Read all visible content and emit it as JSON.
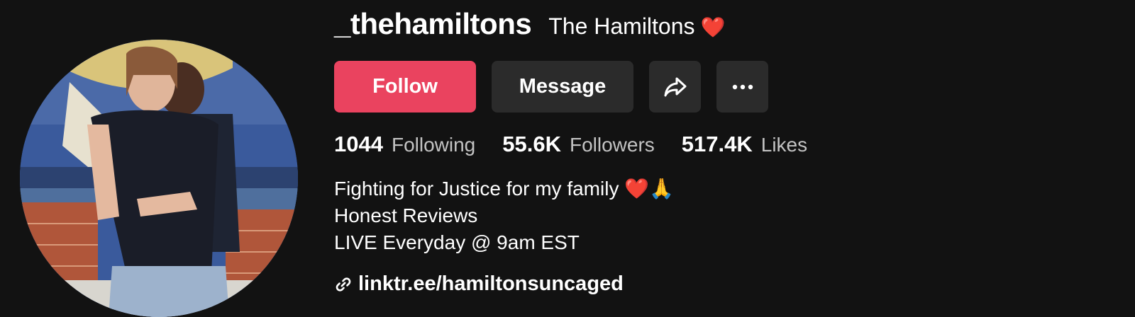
{
  "profile": {
    "username": "_thehamiltons",
    "nickname": "The Hamiltons",
    "nickname_emoji": "❤️",
    "avatar_icon": "profile-photo-couple"
  },
  "actions": {
    "follow_label": "Follow",
    "message_label": "Message",
    "share_icon": "share-arrow-icon",
    "more_icon": "more-dots-icon"
  },
  "stats": {
    "following_count": "1044",
    "following_label": "Following",
    "followers_count": "55.6K",
    "followers_label": "Followers",
    "likes_count": "517.4K",
    "likes_label": "Likes"
  },
  "bio": {
    "line1": "Fighting for Justice for my family",
    "line1_emoji_heart": "❤️",
    "line1_emoji_hands": "🙏",
    "line2": "Honest Reviews",
    "line3": "LIVE Everyday @ 9am EST"
  },
  "link": {
    "text": "linktr.ee/hamiltonsuncaged",
    "icon": "link-icon"
  },
  "colors": {
    "background": "#121212",
    "follow_button": "#ea435f",
    "secondary_button": "#2b2b2b"
  }
}
